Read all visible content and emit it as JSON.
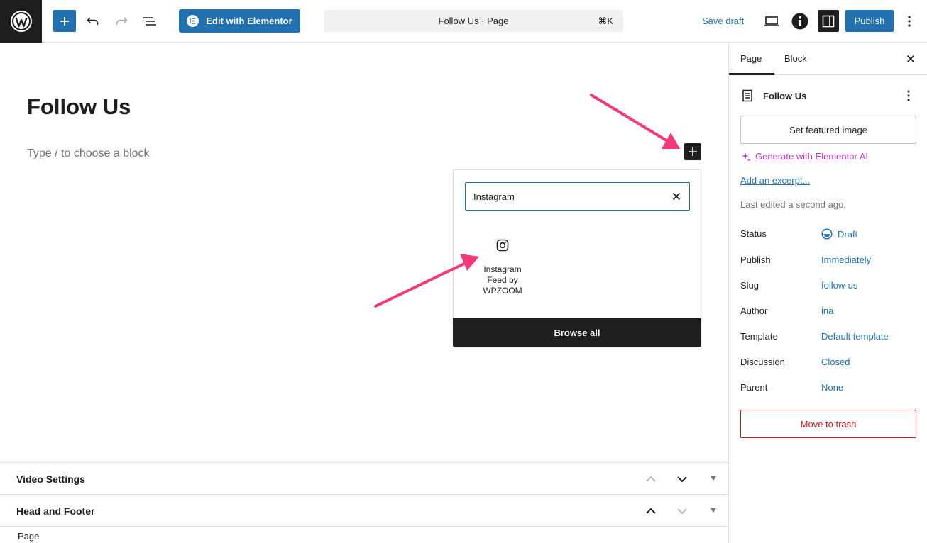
{
  "topbar": {
    "elementor_label": "Edit with Elementor",
    "command_title": "Follow Us · Page",
    "command_shortcut": "⌘K",
    "save_draft": "Save draft",
    "publish": "Publish"
  },
  "editor": {
    "title": "Follow Us",
    "placeholder": "Type / to choose a block"
  },
  "inserter": {
    "search_value": "Instagram",
    "results": [
      {
        "icon": "instagram-icon",
        "label": "Instagram Feed by WPZOOM"
      }
    ],
    "browse_all": "Browse all"
  },
  "metaboxes": [
    {
      "title": "Video Settings"
    },
    {
      "title": "Head and Footer"
    }
  ],
  "statusbar": {
    "label": "Page"
  },
  "sidebar": {
    "tabs": [
      "Page",
      "Block"
    ],
    "doc_title": "Follow Us",
    "featured_image": "Set featured image",
    "elementor_ai": "Generate with Elementor AI",
    "excerpt": "Add an excerpt...",
    "last_edited": "Last edited a second ago.",
    "props": [
      {
        "label": "Status",
        "value": "Draft"
      },
      {
        "label": "Publish",
        "value": "Immediately"
      },
      {
        "label": "Slug",
        "value": "follow-us"
      },
      {
        "label": "Author",
        "value": "ina"
      },
      {
        "label": "Template",
        "value": "Default template"
      },
      {
        "label": "Discussion",
        "value": "Closed"
      },
      {
        "label": "Parent",
        "value": "None"
      }
    ],
    "trash": "Move to trash"
  },
  "colors": {
    "accent": "#2271b1",
    "dark": "#1e1e1e",
    "annotation": "#f5387a",
    "elementor_ai": "#c036d1",
    "danger": "#cc1818"
  }
}
